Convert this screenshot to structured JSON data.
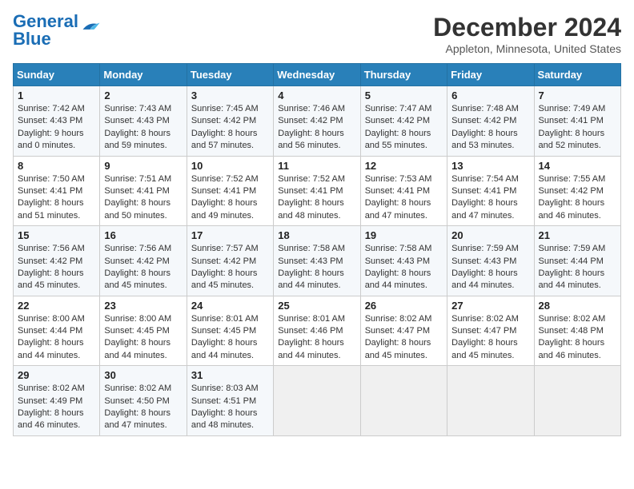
{
  "header": {
    "logo_general": "General",
    "logo_blue": "Blue",
    "month": "December 2024",
    "location": "Appleton, Minnesota, United States"
  },
  "weekdays": [
    "Sunday",
    "Monday",
    "Tuesday",
    "Wednesday",
    "Thursday",
    "Friday",
    "Saturday"
  ],
  "weeks": [
    [
      {
        "day": "1",
        "lines": [
          "Sunrise: 7:42 AM",
          "Sunset: 4:43 PM",
          "Daylight: 9 hours",
          "and 0 minutes."
        ]
      },
      {
        "day": "2",
        "lines": [
          "Sunrise: 7:43 AM",
          "Sunset: 4:43 PM",
          "Daylight: 8 hours",
          "and 59 minutes."
        ]
      },
      {
        "day": "3",
        "lines": [
          "Sunrise: 7:45 AM",
          "Sunset: 4:42 PM",
          "Daylight: 8 hours",
          "and 57 minutes."
        ]
      },
      {
        "day": "4",
        "lines": [
          "Sunrise: 7:46 AM",
          "Sunset: 4:42 PM",
          "Daylight: 8 hours",
          "and 56 minutes."
        ]
      },
      {
        "day": "5",
        "lines": [
          "Sunrise: 7:47 AM",
          "Sunset: 4:42 PM",
          "Daylight: 8 hours",
          "and 55 minutes."
        ]
      },
      {
        "day": "6",
        "lines": [
          "Sunrise: 7:48 AM",
          "Sunset: 4:42 PM",
          "Daylight: 8 hours",
          "and 53 minutes."
        ]
      },
      {
        "day": "7",
        "lines": [
          "Sunrise: 7:49 AM",
          "Sunset: 4:41 PM",
          "Daylight: 8 hours",
          "and 52 minutes."
        ]
      }
    ],
    [
      {
        "day": "8",
        "lines": [
          "Sunrise: 7:50 AM",
          "Sunset: 4:41 PM",
          "Daylight: 8 hours",
          "and 51 minutes."
        ]
      },
      {
        "day": "9",
        "lines": [
          "Sunrise: 7:51 AM",
          "Sunset: 4:41 PM",
          "Daylight: 8 hours",
          "and 50 minutes."
        ]
      },
      {
        "day": "10",
        "lines": [
          "Sunrise: 7:52 AM",
          "Sunset: 4:41 PM",
          "Daylight: 8 hours",
          "and 49 minutes."
        ]
      },
      {
        "day": "11",
        "lines": [
          "Sunrise: 7:52 AM",
          "Sunset: 4:41 PM",
          "Daylight: 8 hours",
          "and 48 minutes."
        ]
      },
      {
        "day": "12",
        "lines": [
          "Sunrise: 7:53 AM",
          "Sunset: 4:41 PM",
          "Daylight: 8 hours",
          "and 47 minutes."
        ]
      },
      {
        "day": "13",
        "lines": [
          "Sunrise: 7:54 AM",
          "Sunset: 4:41 PM",
          "Daylight: 8 hours",
          "and 47 minutes."
        ]
      },
      {
        "day": "14",
        "lines": [
          "Sunrise: 7:55 AM",
          "Sunset: 4:42 PM",
          "Daylight: 8 hours",
          "and 46 minutes."
        ]
      }
    ],
    [
      {
        "day": "15",
        "lines": [
          "Sunrise: 7:56 AM",
          "Sunset: 4:42 PM",
          "Daylight: 8 hours",
          "and 45 minutes."
        ]
      },
      {
        "day": "16",
        "lines": [
          "Sunrise: 7:56 AM",
          "Sunset: 4:42 PM",
          "Daylight: 8 hours",
          "and 45 minutes."
        ]
      },
      {
        "day": "17",
        "lines": [
          "Sunrise: 7:57 AM",
          "Sunset: 4:42 PM",
          "Daylight: 8 hours",
          "and 45 minutes."
        ]
      },
      {
        "day": "18",
        "lines": [
          "Sunrise: 7:58 AM",
          "Sunset: 4:43 PM",
          "Daylight: 8 hours",
          "and 44 minutes."
        ]
      },
      {
        "day": "19",
        "lines": [
          "Sunrise: 7:58 AM",
          "Sunset: 4:43 PM",
          "Daylight: 8 hours",
          "and 44 minutes."
        ]
      },
      {
        "day": "20",
        "lines": [
          "Sunrise: 7:59 AM",
          "Sunset: 4:43 PM",
          "Daylight: 8 hours",
          "and 44 minutes."
        ]
      },
      {
        "day": "21",
        "lines": [
          "Sunrise: 7:59 AM",
          "Sunset: 4:44 PM",
          "Daylight: 8 hours",
          "and 44 minutes."
        ]
      }
    ],
    [
      {
        "day": "22",
        "lines": [
          "Sunrise: 8:00 AM",
          "Sunset: 4:44 PM",
          "Daylight: 8 hours",
          "and 44 minutes."
        ]
      },
      {
        "day": "23",
        "lines": [
          "Sunrise: 8:00 AM",
          "Sunset: 4:45 PM",
          "Daylight: 8 hours",
          "and 44 minutes."
        ]
      },
      {
        "day": "24",
        "lines": [
          "Sunrise: 8:01 AM",
          "Sunset: 4:45 PM",
          "Daylight: 8 hours",
          "and 44 minutes."
        ]
      },
      {
        "day": "25",
        "lines": [
          "Sunrise: 8:01 AM",
          "Sunset: 4:46 PM",
          "Daylight: 8 hours",
          "and 44 minutes."
        ]
      },
      {
        "day": "26",
        "lines": [
          "Sunrise: 8:02 AM",
          "Sunset: 4:47 PM",
          "Daylight: 8 hours",
          "and 45 minutes."
        ]
      },
      {
        "day": "27",
        "lines": [
          "Sunrise: 8:02 AM",
          "Sunset: 4:47 PM",
          "Daylight: 8 hours",
          "and 45 minutes."
        ]
      },
      {
        "day": "28",
        "lines": [
          "Sunrise: 8:02 AM",
          "Sunset: 4:48 PM",
          "Daylight: 8 hours",
          "and 46 minutes."
        ]
      }
    ],
    [
      {
        "day": "29",
        "lines": [
          "Sunrise: 8:02 AM",
          "Sunset: 4:49 PM",
          "Daylight: 8 hours",
          "and 46 minutes."
        ]
      },
      {
        "day": "30",
        "lines": [
          "Sunrise: 8:02 AM",
          "Sunset: 4:50 PM",
          "Daylight: 8 hours",
          "and 47 minutes."
        ]
      },
      {
        "day": "31",
        "lines": [
          "Sunrise: 8:03 AM",
          "Sunset: 4:51 PM",
          "Daylight: 8 hours",
          "and 48 minutes."
        ]
      },
      {
        "day": "",
        "lines": []
      },
      {
        "day": "",
        "lines": []
      },
      {
        "day": "",
        "lines": []
      },
      {
        "day": "",
        "lines": []
      }
    ]
  ]
}
